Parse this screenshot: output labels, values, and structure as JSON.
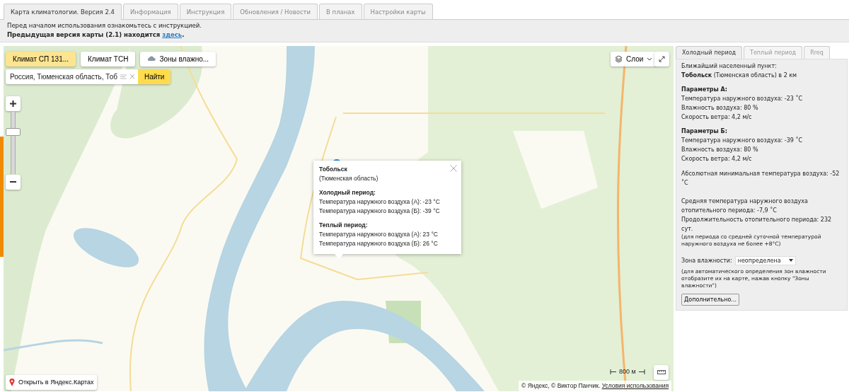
{
  "tabs": [
    {
      "label": "Карта климатологии. Версия 2.4",
      "selected": true
    },
    {
      "label": "Информация",
      "selected": false
    },
    {
      "label": "Инструкция",
      "selected": false
    },
    {
      "label": "Обновления / Новости",
      "selected": false
    },
    {
      "label": "В планах",
      "selected": false
    },
    {
      "label": "Настройки карты",
      "selected": false
    }
  ],
  "notice": {
    "line": "Перед началом использования ознакомьтесь с инструкцией.",
    "previous_before": "Предыдущая версия карты (2.1) находится ",
    "previous_link": "здесь",
    "previous_after": "."
  },
  "map": {
    "layer_buttons": [
      {
        "label": "Климат СП 131...",
        "selected": true,
        "kind": "plain"
      },
      {
        "label": "Климат ТСН",
        "selected": false,
        "kind": "plain"
      },
      {
        "label": "Зоны влажно...",
        "selected": false,
        "kind": "cloud"
      }
    ],
    "search": {
      "value": "Россия, Тюменская область, Тоб",
      "button": "Найти"
    },
    "layers_button": "Слои",
    "zoom": {
      "level": 0.65
    },
    "open_link": "Открыть в Яндекс.Картах",
    "scale": "800 м",
    "attribution": "© Яндекс, © Виктор Панчик.",
    "terms_link": "Условия использования",
    "popup": {
      "title": "Тобольск",
      "region": "(Тюменская область)",
      "sections": [
        {
          "heading": "Холодный период:",
          "lines": [
            "Температура наружного воздуха (А): -23 °C",
            "Температура наружного воздуха (Б): -39 °C"
          ]
        },
        {
          "heading": "Теплый период:",
          "lines": [
            "Температура наружного воздуха (А): 23 °C",
            "Температура наружного воздуха (Б): 26 °C"
          ]
        }
      ]
    }
  },
  "panel": {
    "tabs": [
      {
        "label": "Холодный период",
        "selected": true
      },
      {
        "label": "Теплый период",
        "selected": false
      },
      {
        "label": "Rreq",
        "selected": false
      }
    ],
    "nearest_label": "Ближайший населенный пункт:",
    "nearest": "**Тобольск** (Тюменская область) в 2 км",
    "groups": [
      {
        "heading": "Параметры А:",
        "lines": [
          "Температура наружного воздуха: -23 ˚C",
          "Влажность воздуха: 80 %",
          "Скорость ветра: 4,2 м/с"
        ]
      },
      {
        "heading": "Параметры Б:",
        "lines": [
          "Температура наружного воздуха: -39 ˚C",
          "Влажность воздуха: 80 %",
          "Скорость ветра: 4,2 м/с"
        ]
      }
    ],
    "abs_min": "Абсолютная минимальная температура воздуха: -52 ˚C",
    "avg_temp": "Средняя температура наружного воздуха отопительного периода: -7,9 ˚C",
    "duration": "Продолжительность отопительного периода: 232 сут.",
    "duration_note": "(для периода со средней суточной температурой наружного воздуха не более +8°С)",
    "zone_label": "Зона влажности:",
    "zone_value": "неопределена",
    "zone_note": "(для автоматического определения зон влажности отобразите их на карте, нажав кнопку \"Зоны влажности\")",
    "more_button": "Дополнительно..."
  }
}
